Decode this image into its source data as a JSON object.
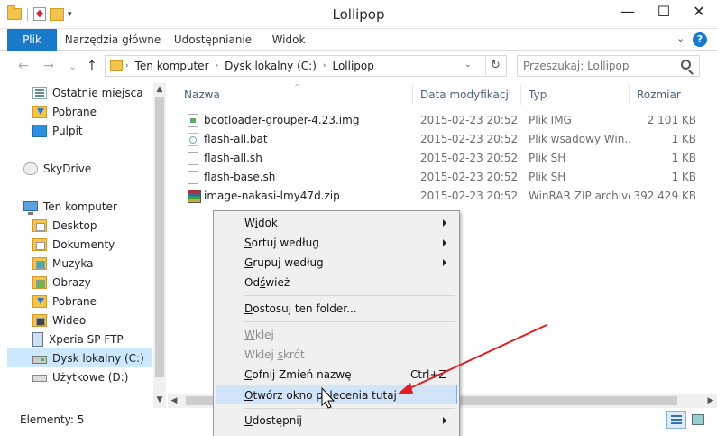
{
  "window": {
    "title": "Lollipop",
    "minimize": "—",
    "maximize": "☐",
    "close": "✕",
    "qa_dropdown": "▾"
  },
  "ribbon": {
    "tabs": [
      "Plik",
      "Narzędzia główne",
      "Udostępnianie",
      "Widok"
    ],
    "expand_glyph": "⌄",
    "help_glyph": "?"
  },
  "nav": {
    "back": "←",
    "forward": "→",
    "recent": "⌄",
    "up": "↑"
  },
  "address": {
    "crumbs": [
      "Ten komputer",
      "Dysk lokalny (C:)",
      "Lollipop"
    ],
    "separator": "›",
    "dropdown": "⌄",
    "refresh": "↻"
  },
  "search": {
    "placeholder": "Przeszukaj: Lollipop"
  },
  "sidebar": {
    "items": [
      {
        "label": "Ostatnie miejsca",
        "icon": "recent-places-icon"
      },
      {
        "label": "Pobrane",
        "icon": "downloads-icon"
      },
      {
        "label": "Pulpit",
        "icon": "desktop-icon"
      },
      {
        "label": "SkyDrive",
        "icon": "skydrive-icon"
      },
      {
        "label": "Ten komputer",
        "icon": "computer-icon"
      },
      {
        "label": "Desktop",
        "icon": "folder-icon"
      },
      {
        "label": "Dokumenty",
        "icon": "documents-icon"
      },
      {
        "label": "Muzyka",
        "icon": "music-icon"
      },
      {
        "label": "Obrazy",
        "icon": "pictures-icon"
      },
      {
        "label": "Pobrane",
        "icon": "downloads-icon"
      },
      {
        "label": "Wideo",
        "icon": "videos-icon"
      },
      {
        "label": "Xperia SP FTP",
        "icon": "phone-icon"
      },
      {
        "label": "Dysk lokalny (C:)",
        "icon": "drive-icon"
      },
      {
        "label": "Użytkowe (D:)",
        "icon": "drive-icon"
      }
    ]
  },
  "columns": [
    "Nazwa",
    "Data modyfikacji",
    "Typ",
    "Rozmiar"
  ],
  "sort_indicator": "^",
  "files": [
    {
      "name": "bootloader-grouper-4.23.img",
      "date": "2015-02-23 20:52",
      "type": "Plik IMG",
      "size": "2 101 KB",
      "icon": "img"
    },
    {
      "name": "flash-all.bat",
      "date": "2015-02-23 20:52",
      "type": "Plik wsadowy Win...",
      "size": "1 KB",
      "icon": "bat"
    },
    {
      "name": "flash-all.sh",
      "date": "2015-02-23 20:52",
      "type": "Plik SH",
      "size": "1 KB",
      "icon": "sh"
    },
    {
      "name": "flash-base.sh",
      "date": "2015-02-23 20:52",
      "type": "Plik SH",
      "size": "1 KB",
      "icon": "sh"
    },
    {
      "name": "image-nakasi-lmy47d.zip",
      "date": "2015-02-23 20:52",
      "type": "WinRAR ZIP archive",
      "size": "392 429 KB",
      "icon": "zip"
    }
  ],
  "status": {
    "item_count": "Elementy: 5"
  },
  "context_menu": {
    "items": [
      {
        "pre": "W",
        "acc": "i",
        "post": "dok",
        "submenu": true,
        "disabled": false
      },
      {
        "pre": "",
        "acc": "S",
        "post": "ortuj według",
        "submenu": true,
        "disabled": false
      },
      {
        "pre": "",
        "acc": "G",
        "post": "rupuj według",
        "submenu": true,
        "disabled": false
      },
      {
        "pre": "Od",
        "acc": "ś",
        "post": "wież",
        "submenu": false,
        "disabled": false
      },
      {
        "pre": "",
        "acc": "D",
        "post": "ostosuj ten folder...",
        "submenu": false,
        "disabled": false
      },
      {
        "pre": "",
        "acc": "W",
        "post": "klej",
        "submenu": false,
        "disabled": true
      },
      {
        "pre": "Wklej ",
        "acc": "s",
        "post": "krót",
        "submenu": false,
        "disabled": true
      },
      {
        "pre": "",
        "acc": "C",
        "post": "ofnij Zmień nazwę",
        "submenu": false,
        "disabled": false,
        "shortcut": "Ctrl+Z"
      },
      {
        "pre": "",
        "acc": "O",
        "post": "twórz okno polecenia tutaj",
        "submenu": false,
        "disabled": false,
        "highlighted": true
      },
      {
        "pre": "",
        "acc": "U",
        "post": "dostępnij",
        "submenu": true,
        "disabled": false
      }
    ]
  },
  "annotation": {
    "arrow_color": "#e02020"
  }
}
